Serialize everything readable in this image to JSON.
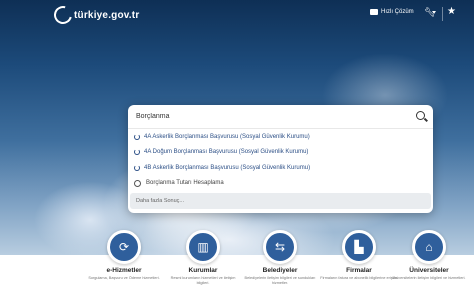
{
  "header": {
    "logo_text": "türkiye.gov.tr",
    "quick_solution_label": "Hızlı Çözüm"
  },
  "search": {
    "value": "Borçlanma",
    "suggestions": [
      {
        "label": "4A Askerlik Borçlanması Başvurusu (Sosyal Güvenlik Kurumu)",
        "type": "service"
      },
      {
        "label": "4A Doğum Borçlanması Başvurusu (Sosyal Güvenlik Kurumu)",
        "type": "service"
      },
      {
        "label": "4B Askerlik Borçlanması Başvurusu (Sosyal Güvenlik Kurumu)",
        "type": "service"
      },
      {
        "label": "Borçlanma Tutarı Hesaplama",
        "type": "search"
      }
    ],
    "more_label": "Daha fazla Sonuç..."
  },
  "categories": [
    {
      "title": "e-Hizmetler",
      "desc": "Sorgulama, Başvuru ve Ödeme hizmetleri.",
      "icon": "refresh-icon"
    },
    {
      "title": "Kurumlar",
      "desc": "Resmi kurumların hizmetleri ve iletişim bilgileri.",
      "icon": "building-icon"
    },
    {
      "title": "Belediyeler",
      "desc": "Belediyelerin iletişim bilgileri ve sundukları hizmetler.",
      "icon": "signpost-icon"
    },
    {
      "title": "Firmalar",
      "desc": "Firmaların fatura ve abonelik bilgilerine erişim.",
      "icon": "factory-icon"
    },
    {
      "title": "Üniversiteler",
      "desc": "Üniversitelerin iletişim bilgileri ve hizmetleri.",
      "icon": "graduation-cap-icon"
    }
  ],
  "colors": {
    "accent": "#2f5f9c",
    "link": "#2c4f86"
  }
}
